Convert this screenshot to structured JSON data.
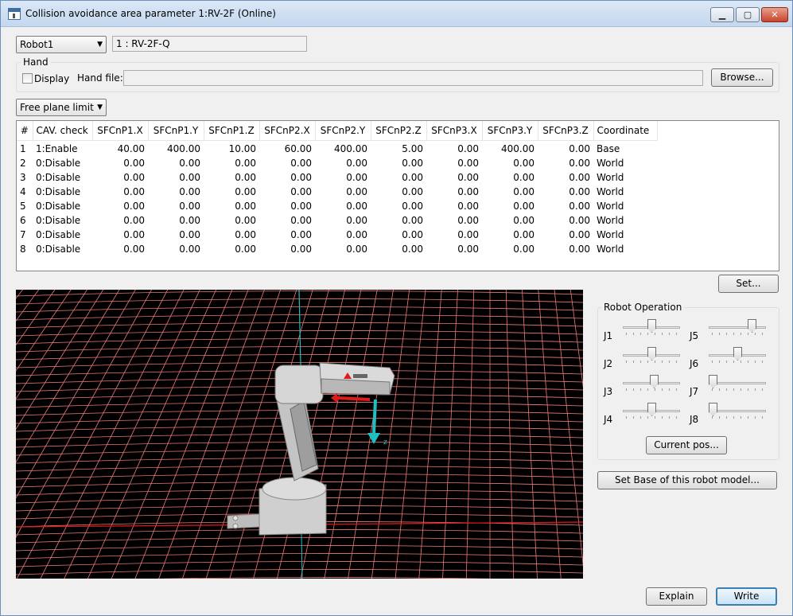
{
  "window": {
    "title": "Collision avoidance area parameter 1:RV-2F (Online)",
    "minimize": "▁",
    "maximize": "▢",
    "close": "✕"
  },
  "robot_select": {
    "value": "Robot1",
    "model": "1 : RV-2F-Q"
  },
  "hand": {
    "group_label": "Hand",
    "display_label": "Display",
    "display_checked": false,
    "file_label": "Hand file:",
    "file_value": "",
    "browse_label": "Browse..."
  },
  "mode_select": {
    "value": "Free plane limit"
  },
  "table": {
    "headers": [
      "#",
      "CAV. check",
      "SFCnP1.X",
      "SFCnP1.Y",
      "SFCnP1.Z",
      "SFCnP2.X",
      "SFCnP2.Y",
      "SFCnP2.Z",
      "SFCnP3.X",
      "SFCnP3.Y",
      "SFCnP3.Z",
      "Coordinate"
    ],
    "rows": [
      [
        "1",
        "1:Enable",
        "40.00",
        "400.00",
        "10.00",
        "60.00",
        "400.00",
        "5.00",
        "0.00",
        "400.00",
        "0.00",
        "Base"
      ],
      [
        "2",
        "0:Disable",
        "0.00",
        "0.00",
        "0.00",
        "0.00",
        "0.00",
        "0.00",
        "0.00",
        "0.00",
        "0.00",
        "World"
      ],
      [
        "3",
        "0:Disable",
        "0.00",
        "0.00",
        "0.00",
        "0.00",
        "0.00",
        "0.00",
        "0.00",
        "0.00",
        "0.00",
        "World"
      ],
      [
        "4",
        "0:Disable",
        "0.00",
        "0.00",
        "0.00",
        "0.00",
        "0.00",
        "0.00",
        "0.00",
        "0.00",
        "0.00",
        "World"
      ],
      [
        "5",
        "0:Disable",
        "0.00",
        "0.00",
        "0.00",
        "0.00",
        "0.00",
        "0.00",
        "0.00",
        "0.00",
        "0.00",
        "World"
      ],
      [
        "6",
        "0:Disable",
        "0.00",
        "0.00",
        "0.00",
        "0.00",
        "0.00",
        "0.00",
        "0.00",
        "0.00",
        "0.00",
        "World"
      ],
      [
        "7",
        "0:Disable",
        "0.00",
        "0.00",
        "0.00",
        "0.00",
        "0.00",
        "0.00",
        "0.00",
        "0.00",
        "0.00",
        "World"
      ],
      [
        "8",
        "0:Disable",
        "0.00",
        "0.00",
        "0.00",
        "0.00",
        "0.00",
        "0.00",
        "0.00",
        "0.00",
        "0.00",
        "World"
      ]
    ]
  },
  "set_button": "Set...",
  "robot_operation": {
    "group_label": "Robot Operation",
    "joints": [
      {
        "label": "J1",
        "level": 0.5
      },
      {
        "label": "J2",
        "level": 0.5
      },
      {
        "label": "J3",
        "level": 0.55
      },
      {
        "label": "J4",
        "level": 0.5
      },
      {
        "label": "J5",
        "level": 0.8
      },
      {
        "label": "J6",
        "level": 0.5
      },
      {
        "label": "J7",
        "level": 0.0
      },
      {
        "label": "J8",
        "level": 0.0
      }
    ],
    "current_pos_label": "Current pos..."
  },
  "set_base_label": "Set Base of this robot model...",
  "explain_label": "Explain",
  "write_label": "Write",
  "colors": {
    "grid_line": "#f07a7a",
    "background_3d": "#000000",
    "axis_cyan": "#1fbfbf",
    "axis_red": "#e01a1a",
    "robot_body": "#d8d8d8"
  }
}
